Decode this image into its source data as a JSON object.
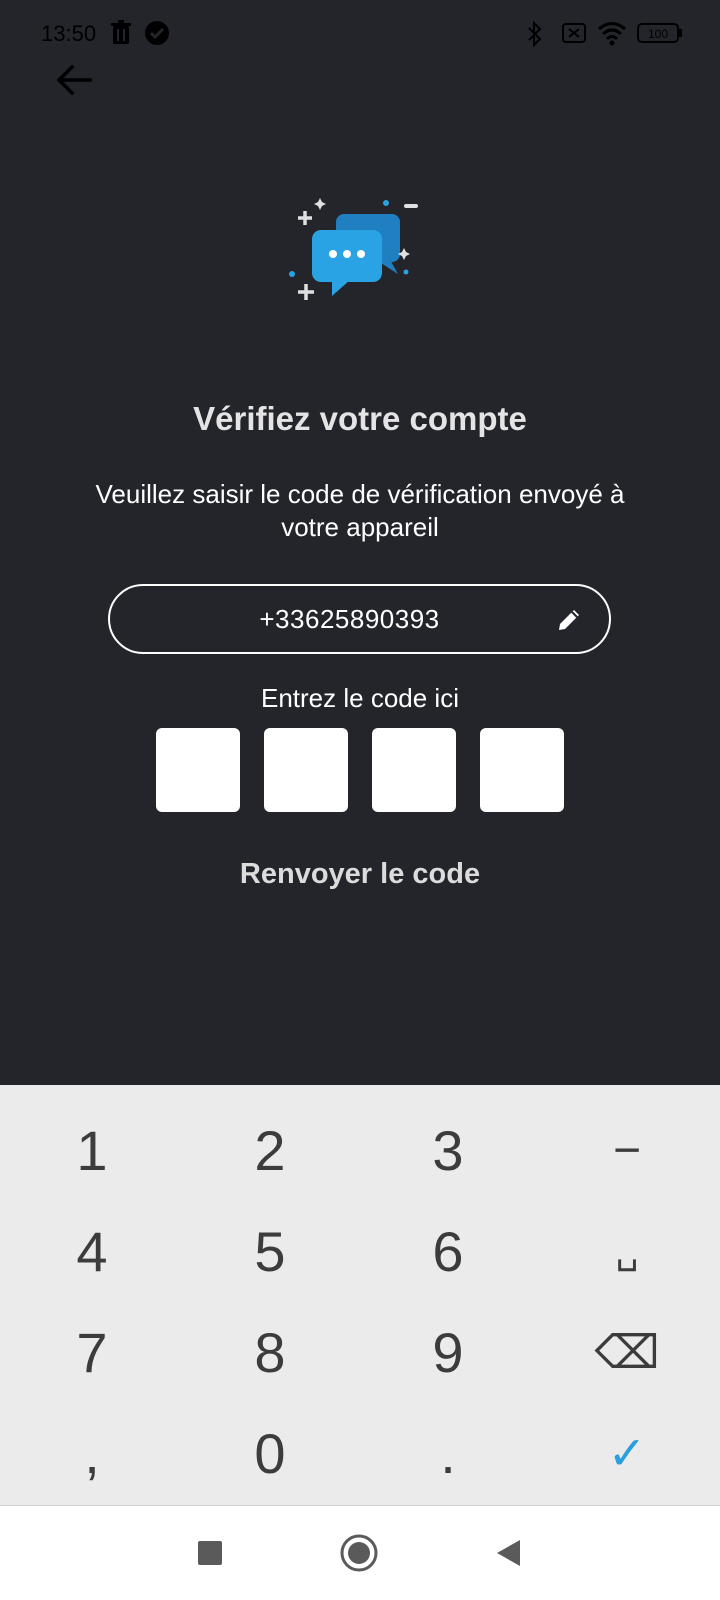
{
  "status_bar": {
    "time": "13:50",
    "battery": "100",
    "icons": [
      "trash-icon",
      "check-circle-icon",
      "bluetooth-icon",
      "sim-off-icon",
      "wifi-icon",
      "battery-icon"
    ]
  },
  "header": {
    "back_icon": "arrow-left-icon"
  },
  "verify": {
    "hero_icon": "chat-bubbles-icon",
    "title": "Vérifiez votre compte",
    "subtitle": "Veuillez saisir le code de vérification envoyé à votre appareil",
    "phone_number": "+33625890393",
    "edit_icon": "pencil-icon",
    "code_label": "Entrez le code ici",
    "code_digits": [
      "",
      "",
      "",
      ""
    ],
    "resend_label": "Renvoyer le code"
  },
  "keyboard": {
    "keys": [
      "1",
      "2",
      "3",
      "−",
      "4",
      "5",
      "6",
      "␣",
      "7",
      "8",
      "9",
      "⌫",
      ",",
      "0",
      ".",
      "✓"
    ],
    "accent_color": "#2a9fe0"
  },
  "navbar": {
    "icons": [
      "recents-square-icon",
      "home-circle-icon",
      "back-triangle-icon"
    ]
  },
  "colors": {
    "background": "#23252b",
    "hero_primary": "#2aa3e4",
    "hero_secondary": "#1f7fc0"
  }
}
